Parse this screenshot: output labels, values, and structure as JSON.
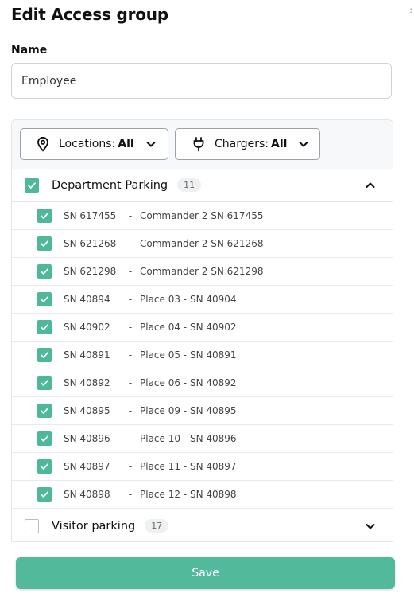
{
  "page": {
    "title": "Edit Access group",
    "corner_mark": ":"
  },
  "form": {
    "name_label": "Name",
    "name_value": "Employee"
  },
  "filters": {
    "locations": {
      "prefix": "Locations:",
      "value": "All"
    },
    "chargers": {
      "prefix": "Chargers:",
      "value": "All"
    }
  },
  "groups": [
    {
      "title": "Department Parking",
      "count": "11",
      "checked": true,
      "expanded": true,
      "chargers": [
        {
          "sn": "SN 617455",
          "name": "Commander 2 SN 617455",
          "checked": true
        },
        {
          "sn": "SN 621268",
          "name": "Commander 2 SN 621268",
          "checked": true
        },
        {
          "sn": "SN 621298",
          "name": "Commander 2 SN 621298",
          "checked": true
        },
        {
          "sn": "SN 40894",
          "name": "Place 03 - SN 40904",
          "checked": true
        },
        {
          "sn": "SN 40902",
          "name": "Place 04 - SN 40902",
          "checked": true
        },
        {
          "sn": "SN 40891",
          "name": "Place 05 - SN 40891",
          "checked": true
        },
        {
          "sn": "SN 40892",
          "name": "Place 06 - SN 40892",
          "checked": true
        },
        {
          "sn": "SN 40895",
          "name": "Place 09 - SN 40895",
          "checked": true
        },
        {
          "sn": "SN 40896",
          "name": "Place 10 - SN 40896",
          "checked": true
        },
        {
          "sn": "SN 40897",
          "name": "Place 11 - SN 40897",
          "checked": true
        },
        {
          "sn": "SN 40898",
          "name": "Place 12 - SN 40898",
          "checked": true
        }
      ]
    },
    {
      "title": "Visitor parking",
      "count": "17",
      "checked": false,
      "expanded": false
    }
  ],
  "separator": "-",
  "actions": {
    "save_label": "Save"
  },
  "colors": {
    "accent": "#4db89a",
    "save_button": "#52b99b"
  },
  "icons": {
    "locations": "location-pin-icon",
    "chargers": "plug-icon",
    "collapse": "chevron-up-icon",
    "expand": "chevron-down-icon"
  }
}
